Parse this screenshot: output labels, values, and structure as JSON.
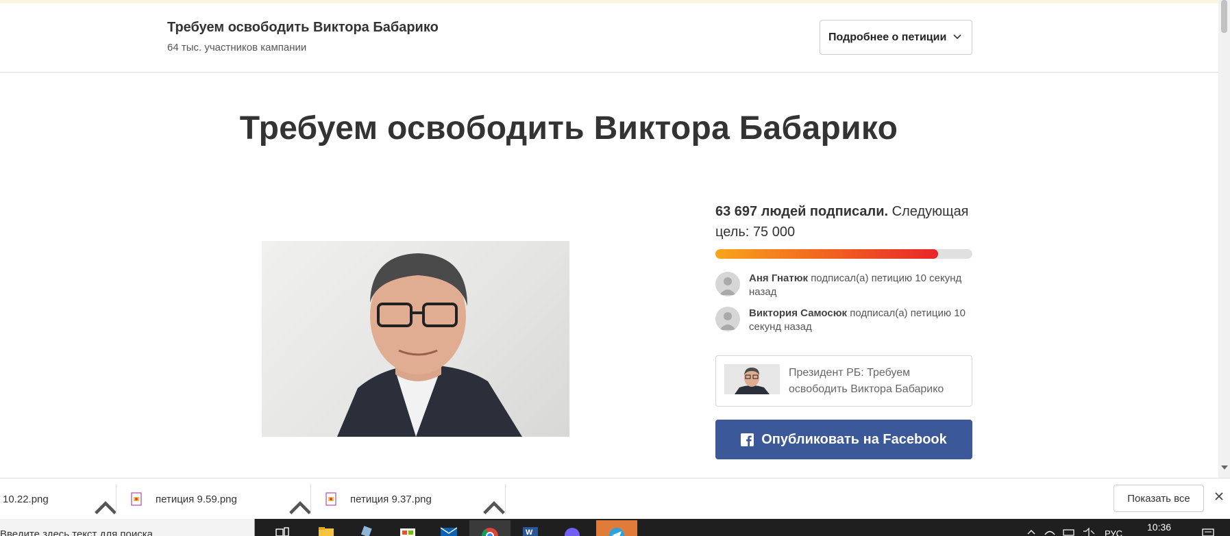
{
  "header": {
    "title": "Требуем освободить Виктора Бабарико",
    "subtitle": "64 тыс. участников кампании",
    "details_button": "Подробнее о петиции"
  },
  "petition": {
    "title": "Требуем освободить Виктора Бабарико",
    "signed_count": "63 697 людей подписали.",
    "next_goal": "Следующая цель: 75 000",
    "progress_fraction": 0.867
  },
  "recent_signers": [
    {
      "name": "Аня Гнатюк",
      "action": "подписал(а) петицию 10 секунд назад"
    },
    {
      "name": "Виктория Самосюк",
      "action": "подписал(а) петицию 10 секунд назад"
    }
  ],
  "share_card": {
    "text": "Президент РБ: Требуем освободить Виктора Бабарико"
  },
  "facebook_button": "Опубликовать на Facebook",
  "downloads": {
    "items": [
      {
        "filename": "10.22.png"
      },
      {
        "filename": "петиция 9.59.png"
      },
      {
        "filename": "петиция 9.37.png"
      }
    ],
    "show_all": "Показать все"
  },
  "taskbar": {
    "search_placeholder": "Введите здесь текст для поиска",
    "language": "РУС",
    "time": "10:36"
  },
  "colors": {
    "facebook_blue": "#3b5998",
    "progress_start": "#f7a51b",
    "progress_end": "#e8262a",
    "taskbar": "#1f1f1f"
  }
}
